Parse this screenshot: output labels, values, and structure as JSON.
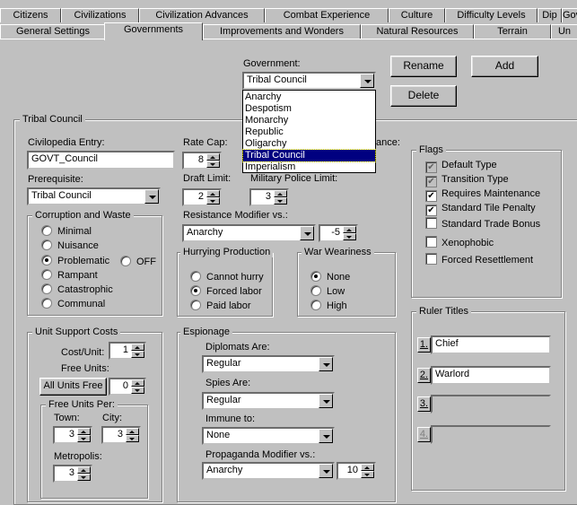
{
  "tabs_row1": [
    "Citizens",
    "Civilizations",
    "Civilization Advances",
    "Combat Experience",
    "Culture",
    "Difficulty Levels",
    "Dip",
    "Gov"
  ],
  "tabs_row2": [
    "General Settings",
    "Governments",
    "Improvements and Wonders",
    "Natural Resources",
    "Terrain",
    "Un"
  ],
  "government": {
    "label": "Government:",
    "selected": "Tribal Council",
    "options": [
      "Anarchy",
      "Despotism",
      "Monarchy",
      "Republic",
      "Oligarchy",
      "Tribal Council",
      "Imperialism"
    ]
  },
  "buttons": {
    "rename": "Rename",
    "add": "Add",
    "delete": "Delete"
  },
  "group_title": "Tribal Council",
  "civilopedia": {
    "label": "Civilopedia Entry:",
    "value": "GOVT_Council"
  },
  "prerequisite": {
    "label": "Prerequisite:",
    "value": "Tribal Council"
  },
  "rate_cap": {
    "label": "Rate Cap:",
    "value": "8"
  },
  "resistance_suffix": "ance:",
  "draft_limit": {
    "label": "Draft Limit:",
    "value": "2"
  },
  "military_police": {
    "label": "Military Police Limit:",
    "value": "3"
  },
  "resistance_modifier": {
    "label": "Resistance Modifier vs.:",
    "value": "Anarchy",
    "amount": "-5"
  },
  "corruption": {
    "title": "Corruption and Waste",
    "options": [
      "Minimal",
      "Nuisance",
      "Problematic",
      "Rampant",
      "Catastrophic",
      "Communal"
    ],
    "off_label": "OFF",
    "selected": "Problematic"
  },
  "hurrying": {
    "title": "Hurrying Production",
    "options": [
      "Cannot hurry",
      "Forced labor",
      "Paid labor"
    ],
    "selected": "Forced labor"
  },
  "war_weariness": {
    "title": "War Weariness",
    "options": [
      "None",
      "Low",
      "High"
    ],
    "selected": "None"
  },
  "flags": {
    "title": "Flags",
    "items": [
      {
        "label": "Default Type",
        "checked": true,
        "disabled": true
      },
      {
        "label": "Transition Type",
        "checked": true,
        "disabled": true
      },
      {
        "label": "Requires Maintenance",
        "checked": true,
        "disabled": false
      },
      {
        "label": "Standard Tile Penalty",
        "checked": true,
        "disabled": false
      },
      {
        "label": "Standard Trade Bonus",
        "checked": false,
        "disabled": false
      },
      {
        "label": "Xenophobic",
        "checked": false,
        "disabled": false
      },
      {
        "label": "Forced Resettlement",
        "checked": false,
        "disabled": false
      }
    ]
  },
  "unit_support": {
    "title": "Unit Support Costs",
    "cost_label": "Cost/Unit:",
    "cost_value": "1",
    "free_label": "Free Units:",
    "all_free_button": "All Units Free",
    "free_value": "0",
    "per_title": "Free Units Per:",
    "town_label": "Town:",
    "town_value": "3",
    "city_label": "City:",
    "city_value": "3",
    "metro_label": "Metropolis:",
    "metro_value": "3"
  },
  "espionage": {
    "title": "Espionage",
    "diplomats_label": "Diplomats Are:",
    "diplomats_value": "Regular",
    "spies_label": "Spies Are:",
    "spies_value": "Regular",
    "immune_label": "Immune to:",
    "immune_value": "None",
    "propaganda_label": "Propaganda Modifier vs.:",
    "propaganda_value": "Anarchy",
    "propaganda_amount": "10"
  },
  "ruler_titles": {
    "title": "Ruler Titles",
    "items": [
      {
        "num": "1.",
        "value": "Chief",
        "enabled": true
      },
      {
        "num": "2.",
        "value": "Warlord",
        "enabled": true
      },
      {
        "num": "3.",
        "value": "",
        "enabled": true
      },
      {
        "num": "4.",
        "value": "",
        "enabled": false
      }
    ]
  }
}
